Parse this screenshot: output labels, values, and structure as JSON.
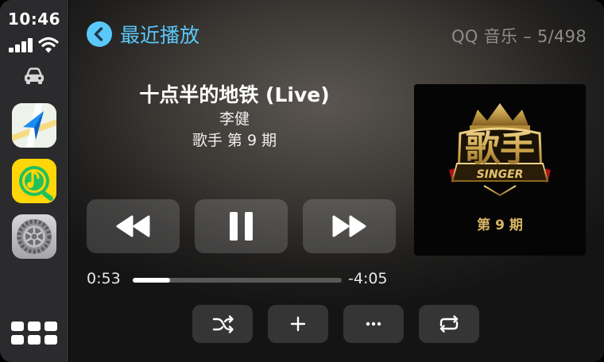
{
  "status_bar": {
    "time": "10:46",
    "icons": [
      "cellular-signal-icon",
      "wifi-icon"
    ],
    "vehicle_icon": "car-icon"
  },
  "sidebar": {
    "apps": [
      {
        "name": "Maps",
        "icon": "maps-app-icon"
      },
      {
        "name": "QQ Music",
        "icon": "qq-music-app-icon"
      },
      {
        "name": "Settings",
        "icon": "settings-app-icon"
      }
    ],
    "home_icon": "app-grid-icon"
  },
  "header": {
    "back_label": "最近播放",
    "app_status": "QQ 音乐 – 5/498"
  },
  "track": {
    "title": "十点半的地铁 (Live)",
    "artist": "李健",
    "album": "歌手 第 9 期"
  },
  "playback": {
    "elapsed": "0:53",
    "remaining": "-4:05",
    "progress": 0.18,
    "state": "playing"
  },
  "controls": {
    "transport": [
      "rewind-icon",
      "pause-icon",
      "fast-forward-icon"
    ],
    "secondary": [
      "shuffle-icon",
      "add-icon",
      "more-icon",
      "repeat-icon"
    ]
  },
  "album_art": {
    "episode_text": "第 9 期",
    "logo_text": "歌手",
    "logo_subtext": "SINGER"
  },
  "colors": {
    "accent": "#5ac8fa",
    "sidebar_bg": "#2b2b2d",
    "album_gold": "#c9a24a"
  }
}
